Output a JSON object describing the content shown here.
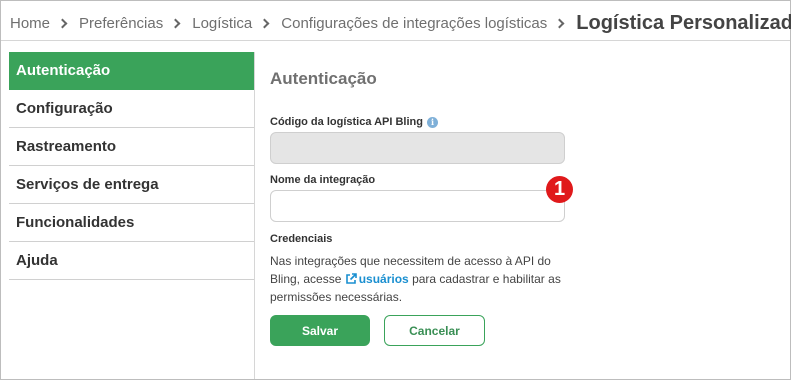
{
  "breadcrumb": {
    "items": [
      "Home",
      "Preferências",
      "Logística",
      "Configurações de integrações logísticas"
    ],
    "current": "Logística Personalizada"
  },
  "sidebar": {
    "items": [
      {
        "label": "Autenticação",
        "active": true
      },
      {
        "label": "Configuração",
        "active": false
      },
      {
        "label": "Rastreamento",
        "active": false
      },
      {
        "label": "Serviços de entrega",
        "active": false
      },
      {
        "label": "Funcionalidades",
        "active": false
      },
      {
        "label": "Ajuda",
        "active": false
      }
    ]
  },
  "main": {
    "title": "Autenticação",
    "code_field": {
      "label": "Código da logística API Bling",
      "value": "",
      "info_icon": "info-icon"
    },
    "name_field": {
      "label": "Nome da integração",
      "value": ""
    },
    "badge": "1",
    "credentials": {
      "label": "Credenciais",
      "text_before": "Nas integrações que necessitem de acesso à API do Bling, acesse ",
      "link_text": "usuários",
      "text_after": " para cadastrar e habilitar as permissões necessárias."
    },
    "buttons": {
      "save": "Salvar",
      "cancel": "Cancelar"
    }
  },
  "colors": {
    "accent": "#3aa35a",
    "link": "#1a8fd0",
    "badge": "#e0191b"
  }
}
